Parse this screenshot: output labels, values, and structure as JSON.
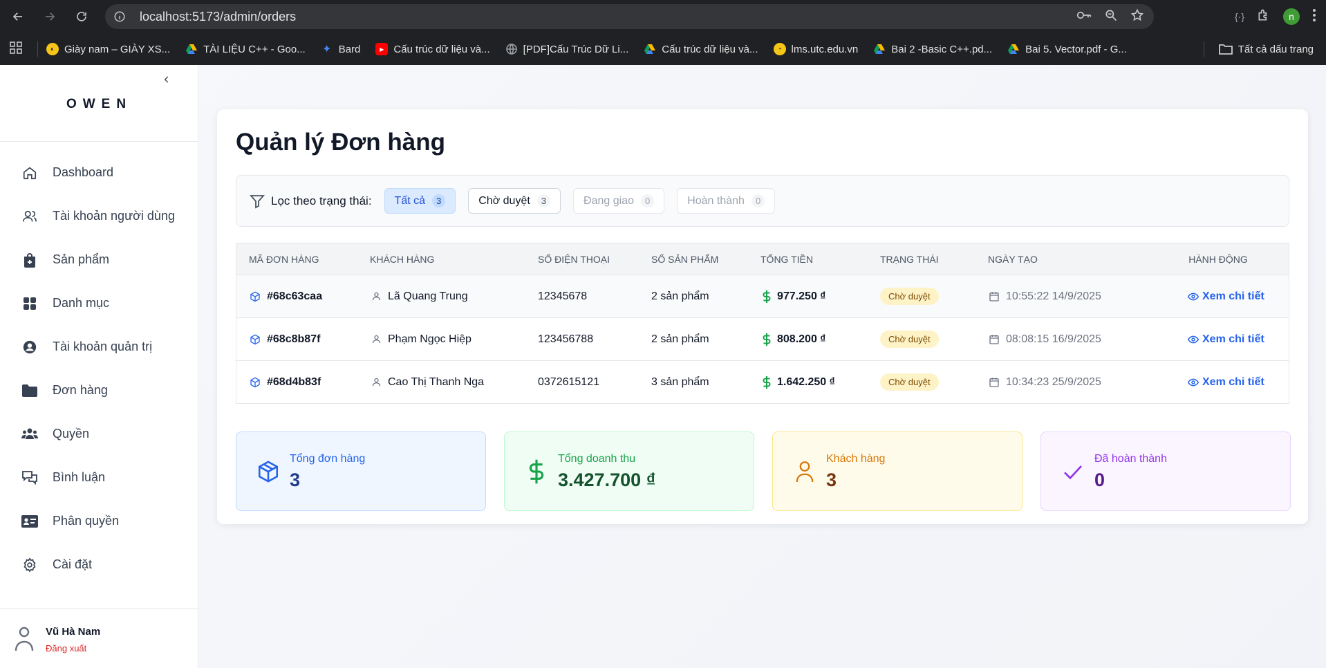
{
  "browser": {
    "url": "localhost:5173/admin/orders",
    "profile_initial": "n",
    "bookmarks": [
      {
        "label": "Giày nam – GIÀY XS...",
        "color": "#f5c518"
      },
      {
        "label": "TÀI LIỆU C++ - Goo...",
        "color": "#1a73e8"
      },
      {
        "label": "Bard",
        "color": "#4285f4"
      },
      {
        "label": "Cấu trúc dữ liệu và...",
        "color": "#ff0000"
      },
      {
        "label": "[PDF]Cấu Trúc Dữ Li...",
        "color": "#9aa0a6"
      },
      {
        "label": "Cấu trúc dữ liệu và...",
        "color": "#1a73e8"
      },
      {
        "label": "lms.utc.edu.vn",
        "color": "#f5c518"
      },
      {
        "label": "Bai 2 -Basic C++.pd...",
        "color": "#1a73e8"
      },
      {
        "label": "Bai 5. Vector.pdf - G...",
        "color": "#1a73e8"
      }
    ],
    "all_bookmarks": "Tất cả dấu trang"
  },
  "sidebar": {
    "logo": "OWEN",
    "items": [
      {
        "label": "Dashboard",
        "icon": "home-icon"
      },
      {
        "label": "Tài khoản người dùng",
        "icon": "users-icon"
      },
      {
        "label": "Sản phẩm",
        "icon": "bag-icon"
      },
      {
        "label": "Danh mục",
        "icon": "grid-icon"
      },
      {
        "label": "Tài khoản quản trị",
        "icon": "user-circle-icon"
      },
      {
        "label": "Đơn hàng",
        "icon": "folder-icon"
      },
      {
        "label": "Quyền",
        "icon": "group-icon"
      },
      {
        "label": "Bình luận",
        "icon": "comments-icon"
      },
      {
        "label": "Phân quyền",
        "icon": "id-card-icon"
      },
      {
        "label": "Cài đặt",
        "icon": "gear-icon"
      }
    ],
    "user": {
      "name": "Vũ Hà Nam",
      "logout": "Đăng xuất"
    }
  },
  "main": {
    "title": "Quản lý Đơn hàng",
    "filter": {
      "label": "Lọc theo trạng thái:",
      "chips": [
        {
          "label": "Tất cả",
          "count": "3"
        },
        {
          "label": "Chờ duyệt",
          "count": "3"
        },
        {
          "label": "Đang giao",
          "count": "0"
        },
        {
          "label": "Hoàn thành",
          "count": "0"
        }
      ]
    },
    "table": {
      "headers": [
        "MÃ ĐƠN HÀNG",
        "KHÁCH HÀNG",
        "SỐ ĐIỆN THOẠI",
        "SỐ SẢN PHẨM",
        "TỔNG TIỀN",
        "TRẠNG THÁI",
        "NGÀY TẠO",
        "HÀNH ĐỘNG"
      ],
      "rows": [
        {
          "id": "#68c63caa",
          "customer": "Lã Quang Trung",
          "phone": "12345678",
          "products": "2 sản phẩm",
          "total": "977.250 ₫",
          "status": "Chờ duyệt",
          "date": "10:55:22 14/9/2025",
          "action": "Xem chi tiết"
        },
        {
          "id": "#68c8b87f",
          "customer": "Phạm Ngọc Hiệp",
          "phone": "123456788",
          "products": "2 sản phẩm",
          "total": "808.200 ₫",
          "status": "Chờ duyệt",
          "date": "08:08:15 16/9/2025",
          "action": "Xem chi tiết"
        },
        {
          "id": "#68d4b83f",
          "customer": "Cao Thị Thanh Nga",
          "phone": "0372615121",
          "products": "3 sản phẩm",
          "total": "1.642.250 ₫",
          "status": "Chờ duyệt",
          "date": "10:34:23 25/9/2025",
          "action": "Xem chi tiết"
        }
      ]
    },
    "stats": [
      {
        "label": "Tổng đơn hàng",
        "value": "3"
      },
      {
        "label": "Tổng doanh thu",
        "value": "3.427.700 ₫"
      },
      {
        "label": "Khách hàng",
        "value": "3"
      },
      {
        "label": "Đã hoàn thành",
        "value": "0"
      }
    ]
  }
}
